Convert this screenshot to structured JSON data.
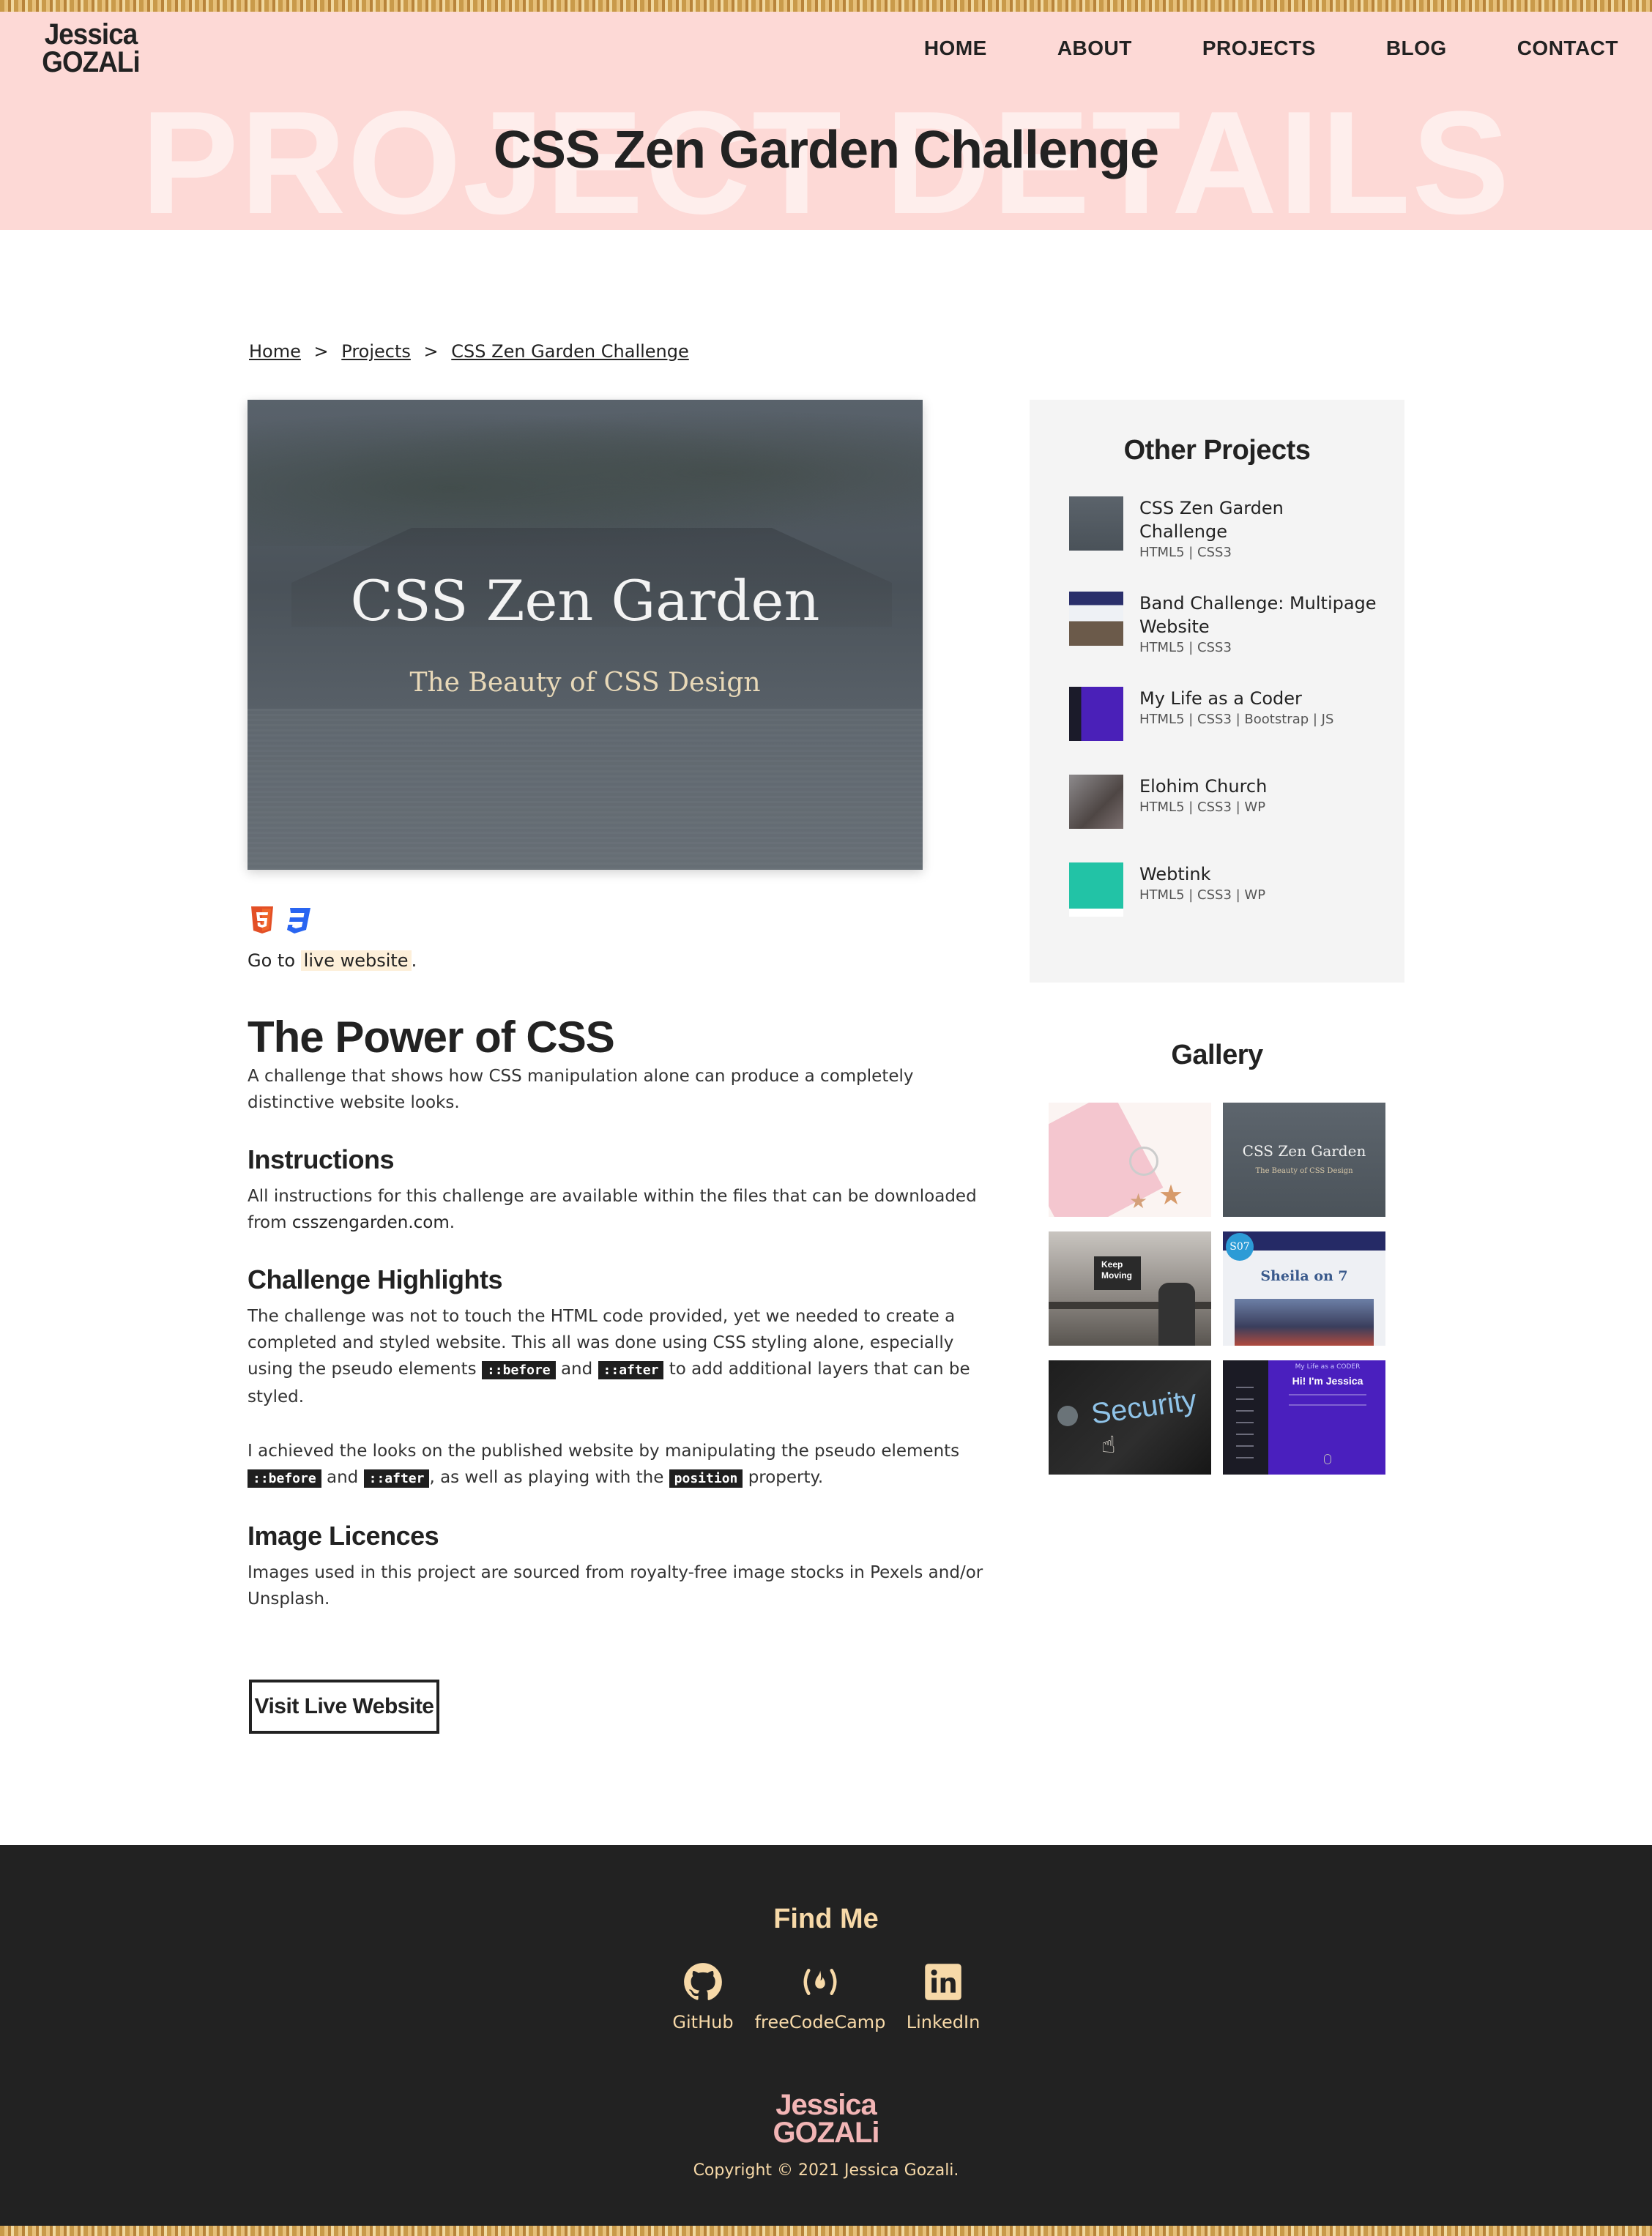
{
  "site": {
    "logo_line1": "Jessica",
    "logo_line2": "GOZALi"
  },
  "nav": {
    "items": [
      "HOME",
      "ABOUT",
      "PROJECTS",
      "BLOG",
      "CONTACT"
    ]
  },
  "hero": {
    "background_text": "PROJECT DETAILS",
    "title": "CSS Zen Garden Challenge"
  },
  "breadcrumb": {
    "items": [
      "Home",
      "Projects",
      "CSS Zen Garden Challenge"
    ],
    "separator": ">"
  },
  "main_image": {
    "title": "CSS Zen Garden",
    "subtitle": "The Beauty of CSS Design"
  },
  "tech": {
    "icons": [
      "html5-icon",
      "css3-icon"
    ]
  },
  "goto": {
    "prefix": "Go to",
    "link": "live website",
    "suffix": "."
  },
  "content": {
    "heading": "The Power of CSS",
    "intro": "A challenge that shows how CSS manipulation alone can produce a completely distinctive website looks.",
    "instructions_heading": "Instructions",
    "instructions_text": "All instructions for this challenge are available within the files that can be downloaded from",
    "instructions_link": "csszengarden.com",
    "instructions_suffix": ".",
    "highlights_heading": "Challenge Highlights",
    "highlights_p1_a": "The challenge was not to touch the HTML code provided, yet we needed to create a completed and styled website. This all was done using CSS styling alone, especially using the pseudo elements",
    "code_before": "::before",
    "and": "and",
    "code_after": "::after",
    "highlights_p1_b": "to add additional layers that can be styled.",
    "highlights_p2_a": "I achieved the looks on the published website by manipulating the pseudo elements",
    "highlights_p2_b": ", as well as playing with the",
    "code_position": "position",
    "highlights_p2_c": "property.",
    "licences_heading": "Image Licences",
    "licences_text": "Images used in this project are sourced from royalty-free image stocks in Pexels and/or Unsplash.",
    "visit_button": "Visit Live Website"
  },
  "sidebar": {
    "other_title": "Other Projects",
    "projects": [
      {
        "title": "CSS Zen Garden Challenge",
        "tags": "HTML5 | CSS3"
      },
      {
        "title": "Band Challenge: Multipage Website",
        "tags": "HTML5 | CSS3"
      },
      {
        "title": "My Life as a Coder",
        "tags": "HTML5 | CSS3 | Bootstrap | JS"
      },
      {
        "title": "Elohim Church",
        "tags": "HTML5 | CSS3 | WP"
      },
      {
        "title": "Webtink",
        "tags": "HTML5 | CSS3 | WP"
      }
    ],
    "gallery_title": "Gallery",
    "gallery_labels": {
      "zen_title": "CSS Zen Garden",
      "zen_sub": "The Beauty of CSS Design",
      "keep": "Keep",
      "moving": "Moving",
      "s07": "S07",
      "sheila": "Sheila on 7",
      "security": "Security",
      "hi": "Hi! I'm Jessica",
      "my_life": "My Life as a CODER"
    }
  },
  "footer": {
    "find_me": "Find Me",
    "social": [
      {
        "label": "GitHub",
        "icon": "github-icon"
      },
      {
        "label": "freeCodeCamp",
        "icon": "freecodecamp-icon"
      },
      {
        "label": "LinkedIn",
        "icon": "linkedin-icon"
      }
    ],
    "logo_line1": "Jessica",
    "logo_line2": "GOZALi",
    "copyright": "Copyright © 2021 Jessica Gozali."
  },
  "colors": {
    "header_bg": "#fdd9d6",
    "footer_bg": "#222222",
    "accent": "#f7d9a8",
    "sidebar_bg": "#f4f4f4"
  }
}
